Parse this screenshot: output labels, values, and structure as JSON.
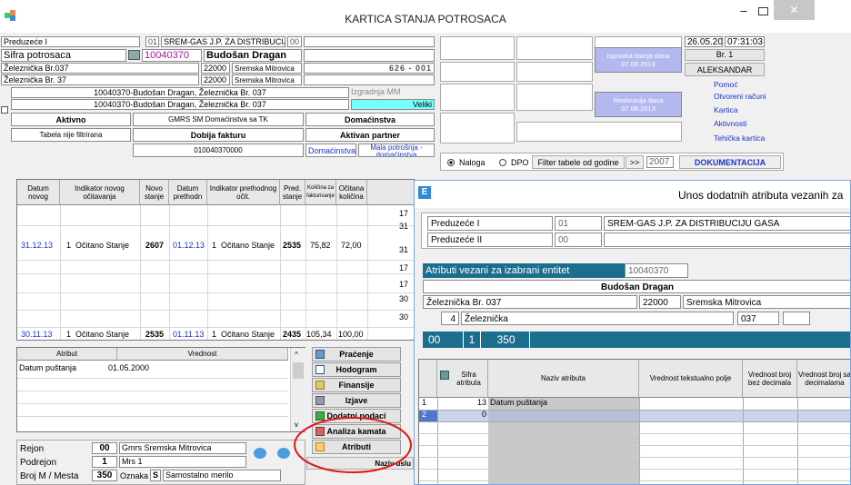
{
  "window": {
    "title": "KARTICA STANJA POTROSACA"
  },
  "left_top": {
    "preduzece_label": "Preduzeće I",
    "preduzece_num": "01",
    "preduzece_name": "SREM-GAS J.P. ZA DISTRIBUCIJU",
    "preduzece_code": "00",
    "sifra_label": "Sifra potrosaca",
    "sifra_value": "10040370",
    "customer_name": "Budošan Dragan",
    "street1": "Železnička Br.037",
    "zip1": "22000",
    "city1": "Sremska Mitrovica",
    "meter": "626 - 001",
    "street2": "Železnička Br. 37",
    "zip2": "22000",
    "city2": "Sremska Mitrovica",
    "full1": "10040370-Budošan Dragan, Železnička Br. 037",
    "izgradnja": "Izgradnja MM",
    "full2": "10040370-Budošan Dragan, Železnička Br. 037",
    "veliki": "Veliki",
    "aktivno": "Aktivno",
    "gmrs": "GMRS SM Domaćinstva sa TK",
    "domacinstva": "Domaćinstva",
    "tabela": "Tabela nije filtrirana",
    "dobija": "Dobija fakturu",
    "aktivan": "Aktivan partner",
    "code": "010040370000",
    "domacinstva2": "Domaćinstva",
    "mala": "Mala potrošnja - domaćinstva"
  },
  "right_top": {
    "date": "26.05.2014",
    "time": "07:31:03",
    "br": "Br. 1",
    "user": "ALEKSANDAR",
    "isp_label": "Ispravka stanja dana",
    "isp_date": "07.08.2013",
    "real_label": "Realizacija dana",
    "real_date": "07.08.2013",
    "links": [
      "Pomoć",
      "Otvoreni računi",
      "Kartica",
      "Aktivnosti",
      "Tehička kartica"
    ],
    "radio_naloga": "Naloga",
    "radio_dpo": "DPO",
    "filter_label": "Filter tabele od godine",
    "filter_btn": ">>",
    "year": "2007",
    "dokumentacija": "DOKUMENTACIJA"
  },
  "readings": {
    "headers": [
      "Datum novog",
      "Indikator novog očitavanja",
      "Novo stanje",
      "Datum prethodn",
      "Indikator prethodnog očit.",
      "Pred. stanje",
      "Količina za fakturisanje",
      "Očitana količina"
    ],
    "right_col": [
      "17",
      "31",
      "",
      "31",
      "",
      "17",
      "17",
      "30",
      "",
      "30",
      "30"
    ],
    "row1": [
      "31.12.13",
      "1",
      "Očitano Stanje",
      "2607",
      "01.12.13",
      "1",
      "Očitano Stanje",
      "2535",
      "75,82",
      "72,00"
    ],
    "row2": [
      "30.11.13",
      "1",
      "Očitano Stanje",
      "2535",
      "01.11.13",
      "1",
      "Očitano Stanje",
      "2435",
      "105,34",
      "100,00"
    ]
  },
  "attr_grid": {
    "headers": [
      "Atribut",
      "Vrednost"
    ],
    "row": [
      "Datum puštanja",
      "01.05.2000"
    ]
  },
  "side_buttons": [
    "Praćenje",
    "Hodogram",
    "Finansije",
    "Izjave",
    "Dodatni podaci",
    "Analiza kamata",
    "Atributi"
  ],
  "naziv_usl": "Naziv uslu",
  "bottom": {
    "rows": [
      {
        "label": "Rejon",
        "num": "00",
        "text": "Gmrs Sremska Mitrovica"
      },
      {
        "label": "Podrejon",
        "num": "1",
        "text": "Mrs 1"
      },
      {
        "label": "Broj M / Mesta",
        "num": "350",
        "oznaka": "Oznaka",
        "s": "S",
        "text": "Samostalno merilo"
      }
    ]
  },
  "dialog": {
    "title": "Unos dodatnih atributa vezanih za",
    "pred1_label": "Preduzeće I",
    "pred1_num": "01",
    "pred1_name": "SREM-GAS J.P. ZA DISTRIBUCIJU GASA",
    "pred2_label": "Preduzeće II",
    "pred2_num": "00",
    "entity_label": "Atributi vezani za izabrani entitet",
    "entity_val": "10040370",
    "name": "Budošan Dragan",
    "street": "Železnička Br. 037",
    "zip": "22000",
    "city": "Sremska Mitrovica",
    "num": "4",
    "street_short": "Železnička",
    "house": "037",
    "bar": [
      "00",
      "1",
      "350"
    ],
    "headers": [
      "Sifra atributa",
      "Naziv atributa",
      "Vrednost tekstualno polje",
      "Vrednost broj bez decimala",
      "Vrednost broj sa decimalama"
    ],
    "rows": [
      {
        "n": "1",
        "code": "13",
        "name": "Datum puštanja"
      },
      {
        "n": "2",
        "code": "0",
        "name": ""
      }
    ]
  }
}
